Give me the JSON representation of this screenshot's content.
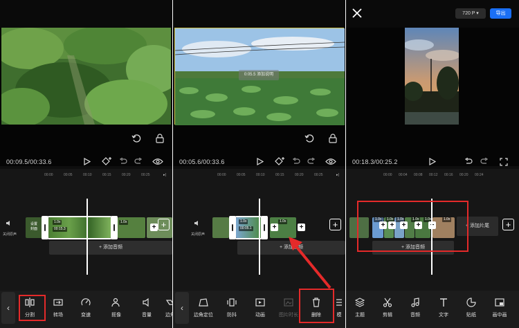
{
  "colors": {
    "accent_blue": "#1a6ff5",
    "highlight_red": "#e52a2a",
    "background": "#0e0e0e"
  },
  "panel1": {
    "timecode": "00:09.5/00:33.6",
    "ruler": [
      "00:00",
      "00:05",
      "00:10",
      "00:15",
      "00:20",
      "00:25"
    ],
    "side_label": "设置\n封面",
    "audio_label": "关闭原声",
    "clip_speed_1": "1.0x",
    "clip_duration": "00:15.3",
    "clip_speed_2": "1.0x",
    "add_audio": "+ 添加音频",
    "tools": [
      {
        "label": "分割",
        "icon": "split-icon"
      },
      {
        "label": "转场",
        "icon": "transition-icon"
      },
      {
        "label": "变速",
        "icon": "speed-icon"
      },
      {
        "label": "抠像",
        "icon": "cutout-icon"
      },
      {
        "label": "音量",
        "icon": "volume-icon"
      },
      {
        "label": "边角",
        "icon": "edge-icon"
      }
    ]
  },
  "panel2": {
    "timecode": "00:05.6/00:33.6",
    "ruler": [
      "00:00",
      "00:05",
      "00:10",
      "00:15",
      "00:20",
      "00:25"
    ],
    "audio_label": "关闭原声",
    "clip_speed_1": "1.0x",
    "clip_duration": "00:05.1",
    "clip_speed_2": "1.0x",
    "add_audio": "+ 添加音频",
    "watermark": "0:05.5 添加说明",
    "tools": [
      {
        "label": "边角定位",
        "icon": "corner-position-icon"
      },
      {
        "label": "防抖",
        "icon": "stabilize-icon"
      },
      {
        "label": "动画",
        "icon": "animation-icon"
      },
      {
        "label": "图片时长",
        "icon": "image-duration-icon"
      },
      {
        "label": "删除",
        "icon": "trash-icon"
      },
      {
        "label": "模",
        "icon": "more-icon"
      }
    ]
  },
  "panel3": {
    "resolution": "720 P",
    "export": "导出",
    "timecode": "00:18.3/00:25.2",
    "ruler": [
      "00:00",
      "00:04",
      "00:08",
      "00:12",
      "00:16",
      "00:20",
      "00:24"
    ],
    "clip_speeds": [
      "1.0x",
      "1.0x",
      "1.0x",
      "1.0x",
      "1.0x",
      "1.0x"
    ],
    "add_tail": "+ 添加片尾",
    "add_audio": "+ 添加音频",
    "tools": [
      {
        "label": "主题",
        "icon": "theme-icon"
      },
      {
        "label": "剪辑",
        "icon": "scissors-icon"
      },
      {
        "label": "音频",
        "icon": "music-icon"
      },
      {
        "label": "文字",
        "icon": "text-icon"
      },
      {
        "label": "贴纸",
        "icon": "sticker-icon"
      },
      {
        "label": "画中画",
        "icon": "pip-icon"
      }
    ]
  }
}
